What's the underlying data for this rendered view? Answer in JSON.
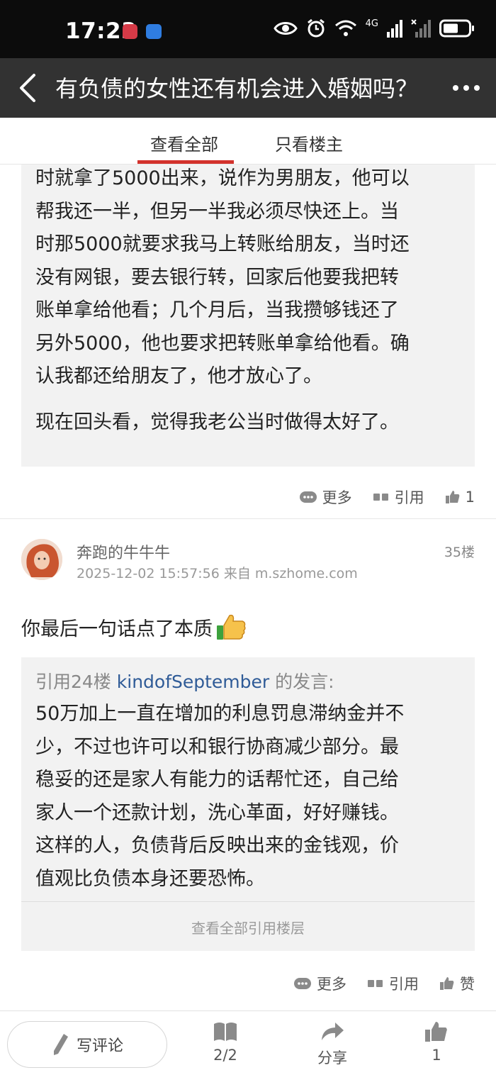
{
  "status_bar": {
    "time": "17:23",
    "network": "4G"
  },
  "nav": {
    "title": "有负债的女性还有机会进入婚姻吗？"
  },
  "tabs": [
    {
      "label": "查看全部"
    },
    {
      "label": "只看楼主"
    }
  ],
  "post1": {
    "lines": [
      "时就拿了5000出来，说作为男朋友，他可以",
      "帮我还一半，但另一半我必须尽快还上。当",
      "时那5000就要求我马上转账给朋友，当时还",
      "没有网银，要去银行转，回家后他要我把转",
      "账单拿给他看；几个月后，当我攒够钱还了",
      "另外5000，他也要求把转账单拿给他看。确",
      "认我都还给朋友了，他才放心了。"
    ],
    "last_line": "现在回头看，觉得我老公当时做得太好了。",
    "actions": {
      "more": "更多",
      "quote": "引用",
      "likes": "1"
    }
  },
  "post2": {
    "author": "奔跑的牛牛牛",
    "floor": "35楼",
    "meta": "2025-12-02 15:57:56  来自 m.szhome.com",
    "reply": "你最后一句话点了本质",
    "quote": {
      "prefix": "引用24楼",
      "user": "kindofSeptember",
      "suffix": "的发言:",
      "lines": [
        "50万加上一直在增加的利息罚息滞纳金并不",
        "少，不过也许可以和银行协商减少部分。最",
        "稳妥的还是家人有能力的话帮忙还，自己给",
        "家人一个还款计划，洗心革面，好好赚钱。",
        "这样的人，负债背后反映出来的金钱观，价",
        "值观比负债本身还要恐怖。"
      ],
      "view_all": "查看全部引用楼层"
    },
    "actions": {
      "more": "更多",
      "quote": "引用",
      "like": "赞"
    }
  },
  "bottom_bar": {
    "comment": "写评论",
    "pages": "2/2",
    "share": "分享",
    "likes": "1"
  },
  "colors": {
    "accent": "#d3322c",
    "nav_bg": "#323232",
    "quote_user": "#2f5b97"
  }
}
